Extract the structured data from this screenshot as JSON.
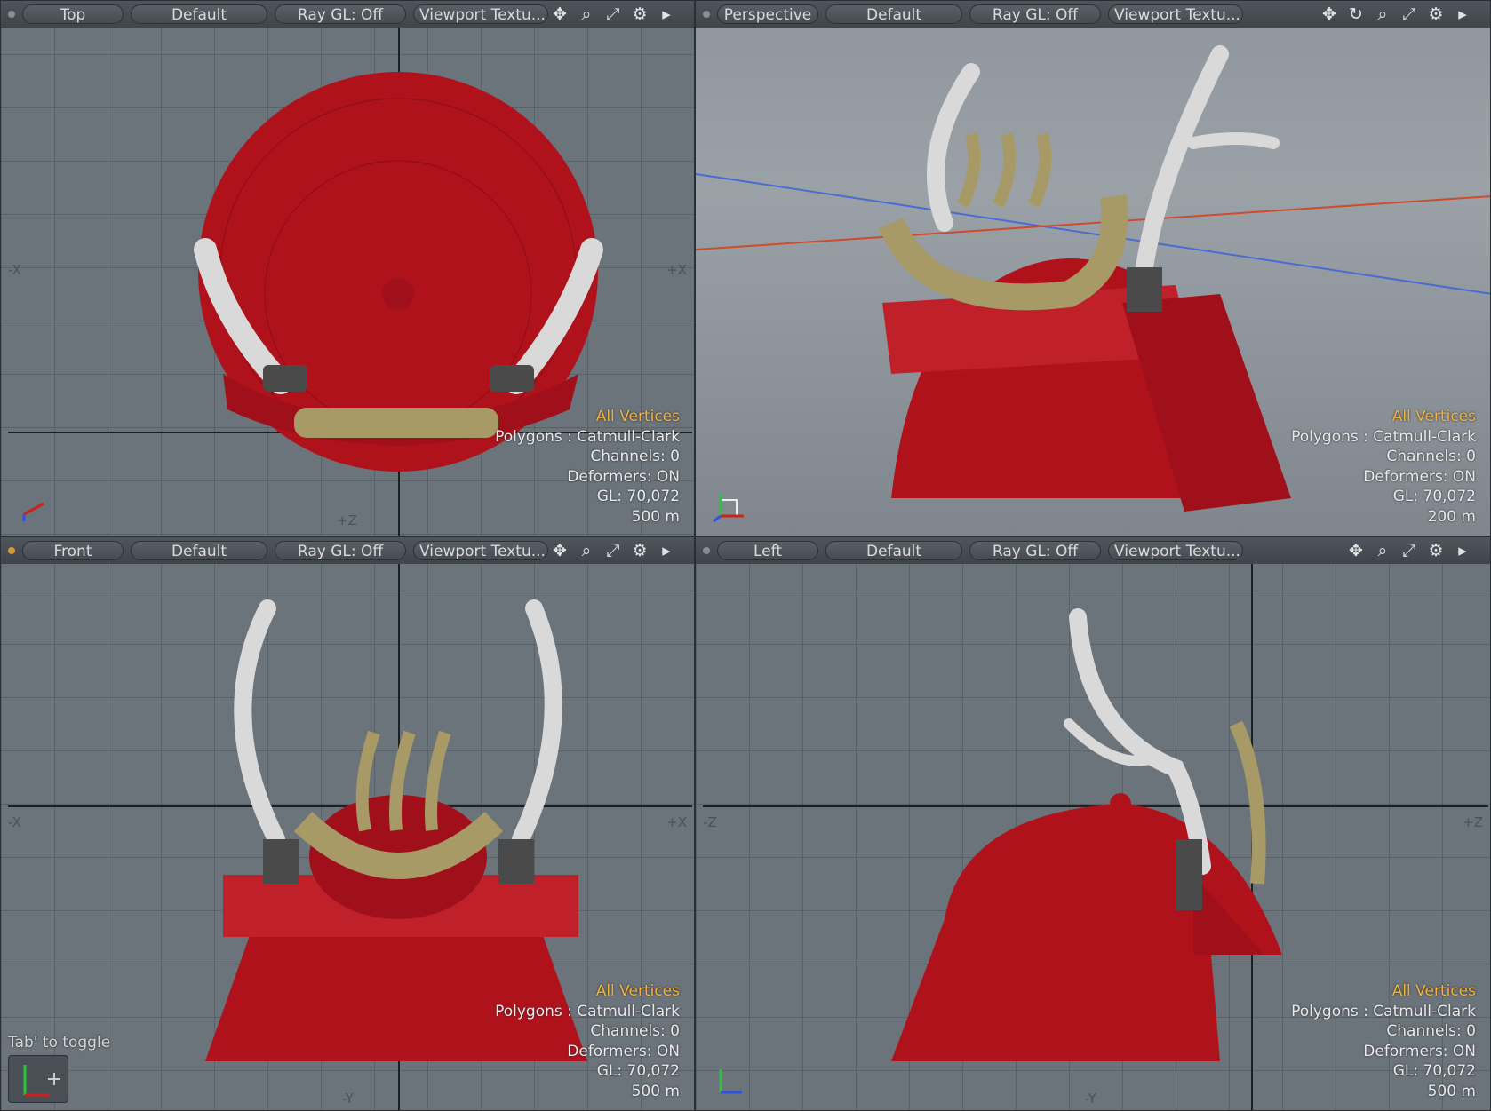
{
  "viewports": [
    {
      "id": "top",
      "view": "Top",
      "shading": "Default",
      "raygl": "Ray GL: Off",
      "style": "Viewport Textu...",
      "axis_left": "-X",
      "axis_right": "+X",
      "axis_bottom": "+Z",
      "info": {
        "selection": "All Vertices",
        "polygons": "Polygons : Catmull-Clark",
        "channels": "Channels: 0",
        "deformers": "Deformers: ON",
        "gl": "GL: 70,072",
        "scale": "500 m"
      }
    },
    {
      "id": "perspective",
      "view": "Perspective",
      "shading": "Default",
      "raygl": "Ray GL: Off",
      "style": "Viewport Textu...",
      "info": {
        "selection": "All Vertices",
        "polygons": "Polygons : Catmull-Clark",
        "channels": "Channels: 0",
        "deformers": "Deformers: ON",
        "gl": "GL: 70,072",
        "scale": "200 m"
      }
    },
    {
      "id": "front",
      "view": "Front",
      "shading": "Default",
      "raygl": "Ray GL: Off",
      "style": "Viewport Textu...",
      "axis_left": "-X",
      "axis_right": "+X",
      "axis_bottom": "-Y",
      "info": {
        "selection": "All Vertices",
        "polygons": "Polygons : Catmull-Clark",
        "channels": "Channels: 0",
        "deformers": "Deformers: ON",
        "gl": "GL: 70,072",
        "scale": "500 m"
      },
      "hint": "Tab' to toggle"
    },
    {
      "id": "left",
      "view": "Left",
      "shading": "Default",
      "raygl": "Ray GL: Off",
      "style": "Viewport Textu...",
      "axis_left": "-Z",
      "axis_right": "+Z",
      "axis_bottom": "-Y",
      "info": {
        "selection": "All Vertices",
        "polygons": "Polygons : Catmull-Clark",
        "channels": "Channels: 0",
        "deformers": "Deformers: ON",
        "gl": "GL: 70,072",
        "scale": "500 m"
      }
    }
  ],
  "colors": {
    "helmet_red": "#b0121c",
    "antler": "#d9d9d9",
    "crest": "#a89a66",
    "selection": "#f0b43c"
  }
}
